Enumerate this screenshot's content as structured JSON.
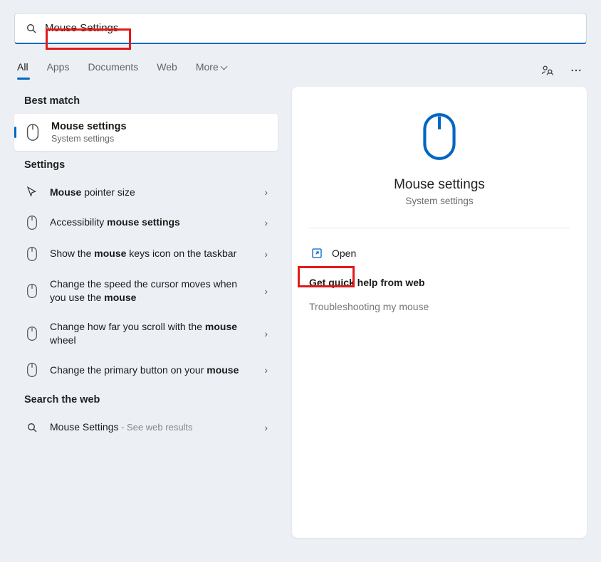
{
  "search": {
    "value": "Mouse Settings"
  },
  "tabs": {
    "all": "All",
    "apps": "Apps",
    "documents": "Documents",
    "web": "Web",
    "more": "More"
  },
  "sections": {
    "best_match": "Best match",
    "settings": "Settings",
    "web": "Search the web"
  },
  "best_match": {
    "title": "Mouse settings",
    "subtitle": "System settings"
  },
  "results": {
    "pointer_size_pre": "Mouse",
    "pointer_size_post": " pointer size",
    "accessibility_pre": "Accessibility ",
    "accessibility_bold": "mouse settings",
    "keys_pre": "Show the ",
    "keys_bold": "mouse",
    "keys_post": " keys icon on the taskbar",
    "speed_pre": "Change the speed the cursor moves when you use the ",
    "speed_bold": "mouse",
    "scroll_pre": "Change how far you scroll with the ",
    "scroll_bold": "mouse",
    "scroll_post": " wheel",
    "primary_pre": "Change the primary button on your ",
    "primary_bold": "mouse",
    "web_title": "Mouse Settings",
    "web_sub": " - See web results"
  },
  "preview": {
    "title": "Mouse settings",
    "subtitle": "System settings",
    "open_label": "Open",
    "help_heading": "Get quick help from web",
    "help_link": "Troubleshooting my mouse"
  }
}
